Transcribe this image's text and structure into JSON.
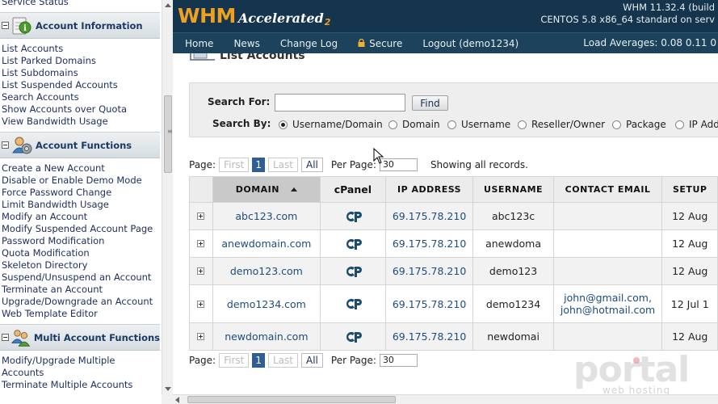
{
  "sidebar": {
    "top_partial_item": "Service Status",
    "groups": [
      {
        "title": "Account Information",
        "icon": "info-icon",
        "items": [
          "List Accounts",
          "List Parked Domains",
          "List Subdomains",
          "List Suspended Accounts",
          "Search Accounts",
          "Show Accounts over Quota",
          "View Bandwidth Usage"
        ]
      },
      {
        "title": "Account Functions",
        "icon": "account-functions-icon",
        "items": [
          "Create a New Account",
          "Disable or Enable Demo Mode",
          "Force Password Change",
          "Limit Bandwidth Usage",
          "Modify an Account",
          "Modify Suspended Account Page",
          "Password Modification",
          "Quota Modification",
          "Skeleton Directory",
          "Suspend/Unsuspend an Account",
          "Terminate an Account",
          "Upgrade/Downgrade an Account",
          "Web Template Editor"
        ]
      },
      {
        "title": "Multi Account Functions",
        "icon": "multi-account-icon",
        "items": [
          "Modify/Upgrade Multiple",
          "Accounts",
          "Terminate Multiple Accounts"
        ]
      }
    ]
  },
  "header": {
    "logo_main": "WHM",
    "logo_sub": "Accelerated",
    "logo_version": "2",
    "version_line": "WHM 11.32.4 (build",
    "os_line": "CENTOS 5.8 x86_64 standard on serv",
    "nav": [
      "Home",
      "News",
      "Change Log",
      "Secure",
      "Logout (demo1234)"
    ],
    "load_averages": "Load Averages: 0.08 0.11 0"
  },
  "main": {
    "title": "List Accounts",
    "search": {
      "label": "Search For:",
      "value": "",
      "find_label": "Find",
      "search_by_label": "Search By:",
      "options": [
        "Username/Domain",
        "Domain",
        "Username",
        "Reseller/Owner",
        "Package",
        "IP Add"
      ],
      "selected": "Username/Domain"
    },
    "pager": {
      "page_label": "Page:",
      "first": "First",
      "current": "1",
      "last": "Last",
      "all": "All",
      "per_page_label": "Per Page:",
      "per_page": "30",
      "status": "Showing all records."
    },
    "table": {
      "columns": [
        "Domain",
        "cPanel",
        "IP Address",
        "Username",
        "Contact Email",
        "Setup"
      ],
      "rows": [
        {
          "domain": "abc123.com",
          "ip": "69.175.78.210",
          "username": "abc123c",
          "email": "",
          "email2": "",
          "setup": "12 Aug"
        },
        {
          "domain": "anewdomain.com",
          "ip": "69.175.78.210",
          "username": "anewdoma",
          "email": "",
          "email2": "",
          "setup": "12 Aug"
        },
        {
          "domain": "demo123.com",
          "ip": "69.175.78.210",
          "username": "demo123",
          "email": "",
          "email2": "",
          "setup": "12 Aug"
        },
        {
          "domain": "demo1234.com",
          "ip": "69.175.78.210",
          "username": "demo1234",
          "email": "john@gmail.com,",
          "email2": "john@hotmail.com",
          "setup": "12 Jul 1"
        },
        {
          "domain": "newdomain.com",
          "ip": "69.175.78.210",
          "username": "newdomai",
          "email": "",
          "email2": "",
          "setup": "12 Aug"
        }
      ]
    }
  },
  "watermark": {
    "text": "portal",
    "sub": "web hosting"
  },
  "colors": {
    "topbar": "#14354d",
    "navbar": "#1d425c",
    "logo_orange": "#f0a020",
    "link": "#1c4d7c",
    "sidebar_link": "#1c2e5a"
  }
}
